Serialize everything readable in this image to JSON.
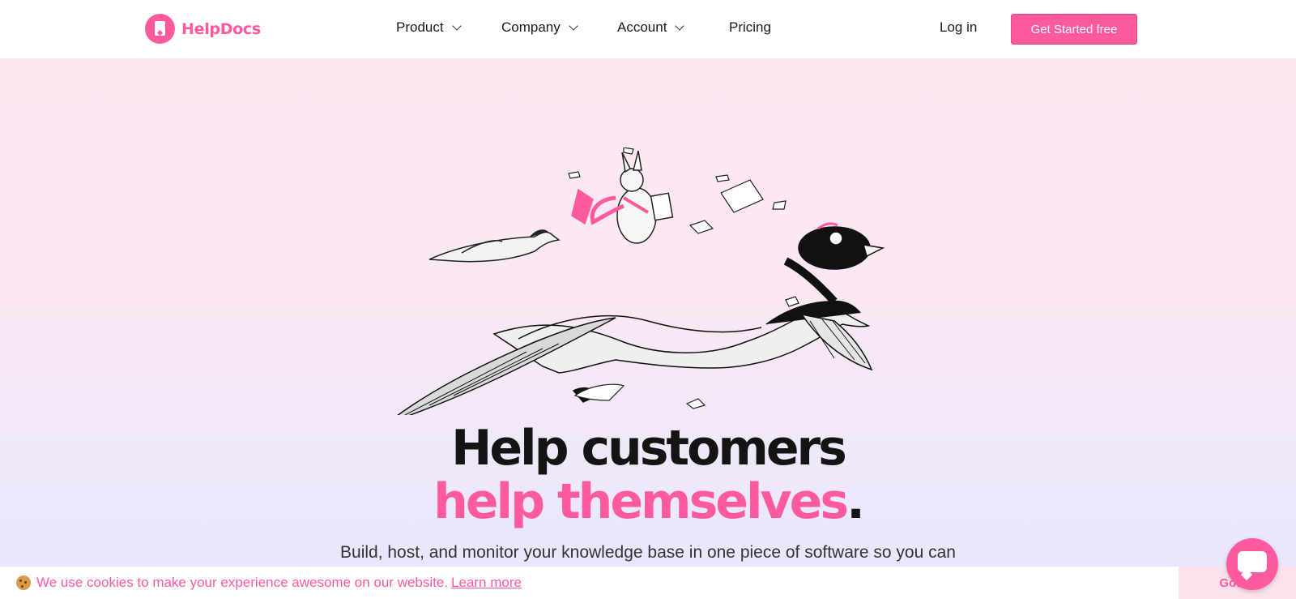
{
  "brand": {
    "name": "HelpDocs",
    "accent": "#ff5a9e"
  },
  "nav": {
    "items": [
      {
        "label": "Product",
        "dropdown": true
      },
      {
        "label": "Company",
        "dropdown": true
      },
      {
        "label": "Account",
        "dropdown": true
      },
      {
        "label": "Pricing",
        "dropdown": false
      }
    ],
    "login": "Log in",
    "cta": "Get Started free"
  },
  "hero": {
    "title_line1": "Help customers",
    "title_line2": "help themselves",
    "title_period": ".",
    "subtitle": "Build, host, and monitor your knowledge base in one piece of software so you can"
  },
  "cookie": {
    "text": "We use cookies to make your experience awesome on our website.",
    "link": "Learn more",
    "accept": "Got it!"
  },
  "icons": {
    "logo": "helpdocs-logo-icon",
    "chevron": "chevron-down-icon",
    "cookie": "cookie-icon",
    "chat": "chat-icon"
  }
}
